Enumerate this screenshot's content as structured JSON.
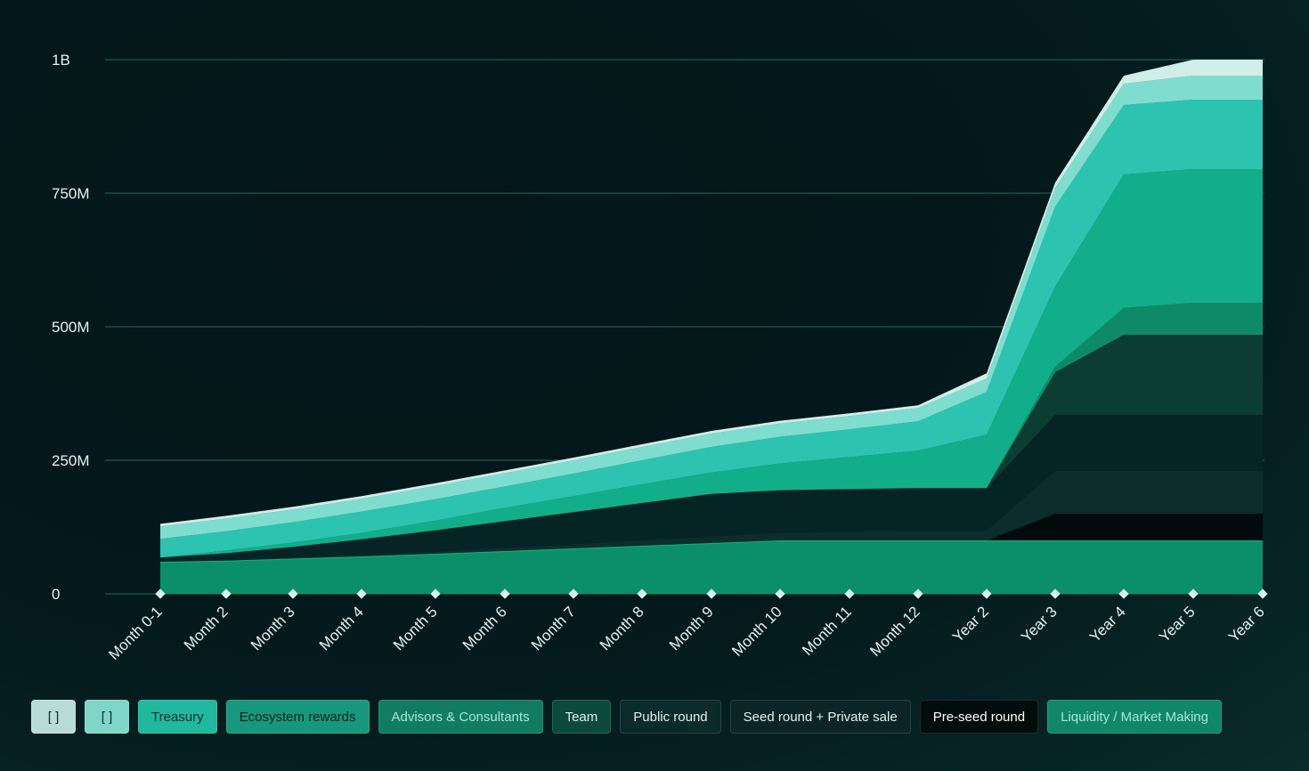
{
  "chart_data": {
    "type": "area",
    "stacked": true,
    "categories": [
      "Month 0-1",
      "Month 2",
      "Month 3",
      "Month 4",
      "Month 5",
      "Month 6",
      "Month 7",
      "Month 8",
      "Month 9",
      "Month 10",
      "Month 11",
      "Month 12",
      "Year 2",
      "Year 3",
      "Year 4",
      "Year 5",
      "Year 6"
    ],
    "y_ticks": [
      "0",
      "250M",
      "500M",
      "750M",
      "1B"
    ],
    "ylim": [
      0,
      1000000000
    ],
    "grid": true,
    "legend_position": "bottom",
    "series": [
      {
        "name": "Liquidity / Market Making",
        "color": "#0b8f6a",
        "values": [
          60,
          62,
          66,
          70,
          75,
          80,
          85,
          90,
          95,
          100,
          100,
          100,
          100,
          100,
          100,
          100,
          100
        ]
      },
      {
        "name": "Pre-seed round",
        "color": "#020b0b",
        "values": [
          0,
          0,
          0,
          0,
          0,
          0,
          0,
          0,
          0,
          0,
          0,
          0,
          0,
          50,
          50,
          50,
          50
        ]
      },
      {
        "name": "Seed round + Private sale",
        "color": "#0d2d2d",
        "values": [
          0,
          0,
          0,
          2,
          4,
          6,
          8,
          10,
          12,
          14,
          16,
          18,
          18,
          80,
          80,
          80,
          80
        ]
      },
      {
        "name": "Public round",
        "color": "#062426",
        "values": [
          8,
          14,
          22,
          30,
          40,
          50,
          60,
          70,
          80,
          80,
          80,
          80,
          80,
          105,
          105,
          105,
          105
        ]
      },
      {
        "name": "Team",
        "color": "#0b3d33",
        "values": [
          0,
          0,
          0,
          0,
          0,
          0,
          0,
          0,
          0,
          0,
          0,
          0,
          0,
          80,
          150,
          150,
          150
        ]
      },
      {
        "name": "Advisors & Consultants",
        "color": "#0f8a68",
        "values": [
          0,
          0,
          0,
          0,
          0,
          0,
          0,
          0,
          0,
          0,
          0,
          0,
          0,
          10,
          50,
          60,
          60
        ]
      },
      {
        "name": "Ecosystem rewards",
        "color": "#12ae8a",
        "values": [
          0,
          5,
          8,
          12,
          18,
          25,
          30,
          35,
          40,
          50,
          60,
          70,
          100,
          150,
          250,
          250,
          250
        ]
      },
      {
        "name": "Treasury",
        "color": "#2cc4b0",
        "values": [
          35,
          36,
          38,
          40,
          40,
          40,
          42,
          45,
          48,
          50,
          52,
          55,
          80,
          150,
          130,
          130,
          130
        ]
      },
      {
        "name": "[ ]",
        "color": "#7fddcf",
        "values": [
          23,
          24,
          24,
          24,
          25,
          25,
          25,
          25,
          25,
          25,
          25,
          25,
          25,
          35,
          40,
          45,
          45
        ]
      },
      {
        "name": "[ ]",
        "color": "#cfeeea",
        "values": [
          5,
          5,
          5,
          5,
          5,
          5,
          5,
          5,
          5,
          5,
          5,
          5,
          10,
          10,
          15,
          30,
          30
        ]
      }
    ]
  },
  "legend": [
    {
      "label": "[ ]",
      "bg": "#b9dcd8",
      "fg": "#07312c"
    },
    {
      "label": "[ ]",
      "bg": "#7fd6c8",
      "fg": "#07312c"
    },
    {
      "label": "Treasury",
      "bg": "#20b89f",
      "fg": "#07312c"
    },
    {
      "label": "Ecosystem rewards",
      "bg": "#17987e",
      "fg": "#04231f"
    },
    {
      "label": "Advisors & Consultants",
      "bg": "#117c63",
      "fg": "#a6e6d8"
    },
    {
      "label": "Team",
      "bg": "#0b4a3d",
      "fg": "#dff3ee"
    },
    {
      "label": "Public round",
      "bg": "#0a2b2c",
      "fg": "#dff3ee"
    },
    {
      "label": "Seed round + Private sale",
      "bg": "#0b2526",
      "fg": "#dff3ee"
    },
    {
      "label": "Pre-seed round",
      "bg": "#030c0c",
      "fg": "#ffffff"
    },
    {
      "label": "Liquidity / Market Making",
      "bg": "#10866b",
      "fg": "#a6e6d8"
    }
  ]
}
